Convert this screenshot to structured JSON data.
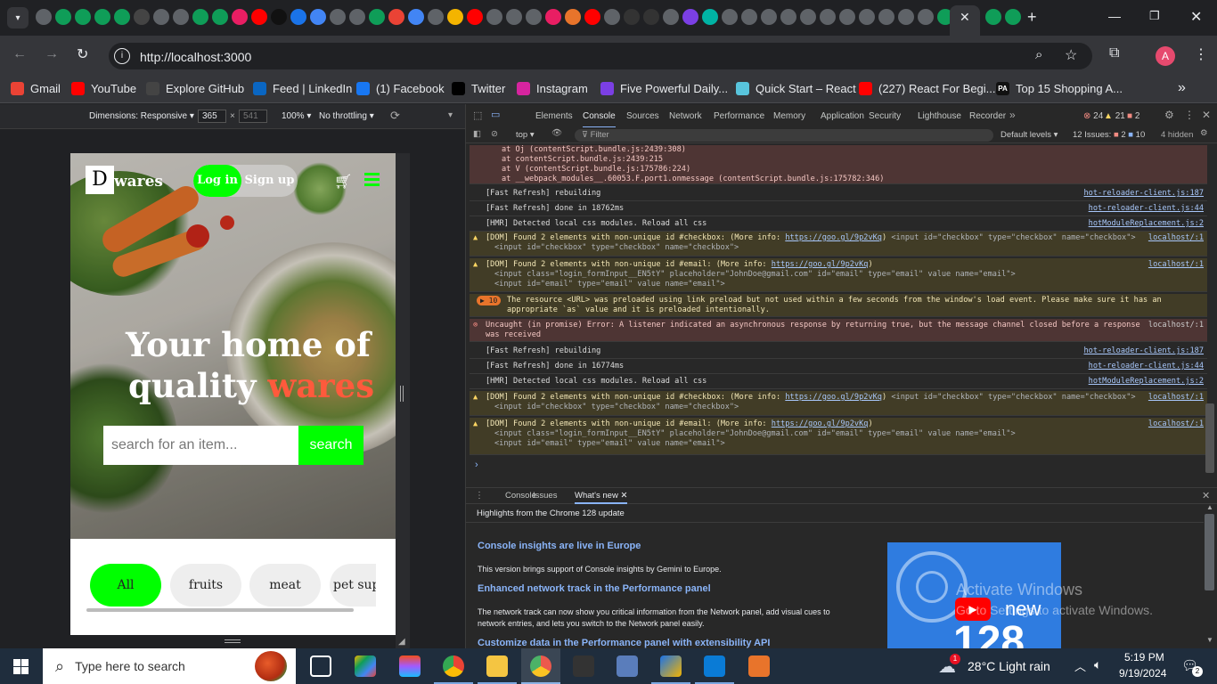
{
  "browser": {
    "url": "http://localhost:3000",
    "avatar_letter": "A",
    "bookmarks": [
      {
        "label": "Gmail",
        "icon": "gmail-icon",
        "color": "#ea4335"
      },
      {
        "label": "YouTube",
        "icon": "youtube-icon",
        "color": "#ff0000"
      },
      {
        "label": "Explore GitHub",
        "icon": "github-icon",
        "color": "#444"
      },
      {
        "label": "Feed | LinkedIn",
        "icon": "linkedin-icon",
        "color": "#0a66c2"
      },
      {
        "label": "(1) Facebook",
        "icon": "facebook-icon",
        "color": "#1877f2"
      },
      {
        "label": "Twitter",
        "icon": "x-icon",
        "color": "#000"
      },
      {
        "label": "Instagram",
        "icon": "instagram-icon",
        "color": "#d6249f"
      },
      {
        "label": "Five Powerful Daily...",
        "icon": "bookmark-icon",
        "color": "#7b3fe4"
      },
      {
        "label": "Quick Start – React",
        "icon": "react-icon",
        "color": "#58c4dc"
      },
      {
        "label": "(227) React For Begi...",
        "icon": "youtube-icon",
        "color": "#ff0000"
      },
      {
        "label": "Top 15 Shopping A...",
        "icon": "pa-icon",
        "color": "#111"
      }
    ],
    "bookmark_pa": "PA"
  },
  "device_toolbar": {
    "dimensions_label": "Dimensions: Responsive",
    "width": "365",
    "height": "541",
    "times": "×",
    "zoom": "100%",
    "throttling": "No throttling"
  },
  "site": {
    "logo_letter": "D",
    "logo_text": "wares",
    "login_label": "Log in",
    "signup_label": "Sign up",
    "hero_line1": "Your home of",
    "hero_line2_a": "quality ",
    "hero_line2_b": "wares",
    "search_placeholder": "search for an item...",
    "search_button": "search",
    "categories": [
      "All",
      "fruits",
      "meat",
      "pet supp"
    ],
    "accent": "#00ff00",
    "highlight": "#ff5a3c"
  },
  "devtools": {
    "tabs": [
      "Elements",
      "Console",
      "Sources",
      "Network",
      "Performance",
      "Memory",
      "Application",
      "Security",
      "Lighthouse",
      "Recorder"
    ],
    "more_tabs": "»",
    "err_count": "24",
    "warn_count": "21",
    "info_count": "2",
    "context": "top",
    "filter_placeholder": "Filter",
    "levels": "Default levels",
    "issues_label": "12 Issues:",
    "issues_err": "2",
    "issues_info": "10",
    "hidden": "4 hidden",
    "stack": [
      "at Oj (contentScript.bundle.js:2439:308)",
      "at contentScript.bundle.js:2439:215",
      "at V (contentScript.bundle.js:175786:224)",
      "at __webpack_modules__.60053.F.port1.onmessage (contentScript.bundle.js:175782:346)"
    ],
    "logs": {
      "fr1": "[Fast Refresh] rebuilding",
      "fr1_src": "hot-reloader-client.js:187",
      "fr2": "[Fast Refresh] done in 18762ms",
      "fr2_src": "hot-reloader-client.js:44",
      "hmr1": "[HMR] Detected local css modules. Reload all css",
      "hmr1_src": "hotModuleReplacement.js:2",
      "w1": "[DOM] Found 2 elements with non-unique id #checkbox: (More info: ",
      "w1_link": "https://goo.gl/9p2vKq",
      "w1_tail": ")",
      "w1_code": "<input id=\"checkbox\" type=\"checkbox\" name=\"checkbox\">",
      "w1_src": "localhost/:1",
      "w2": "[DOM] Found 2 elements with non-unique id #email: (More info: ",
      "w2_link": "https://goo.gl/9p2vKq",
      "w2_tail": ")",
      "w2_code1": "<input class=\"login_formInput__EN5tY\" placeholder=\"JohnDoe@gmail.com\" id=\"email\" type=\"email\" value name=\"email\">",
      "w2_code2": "<input id=\"email\" type=\"email\" value name=\"email\">",
      "w2_src": "localhost/:1",
      "w3_badge": "10",
      "w3": "The resource <URL> was preloaded using link preload but not used within a few seconds from the window's load event. Please make sure it has an",
      "w3b": "appropriate `as` value and it is preloaded intentionally.",
      "e1": "Uncaught (in promise) Error: A listener indicated an asynchronous response by returning true, but the message channel closed before a response",
      "e1b": "was received",
      "e1_src": "localhost/:1",
      "fr3": "[Fast Refresh] rebuilding",
      "fr3_src": "hot-reloader-client.js:187",
      "fr4": "[Fast Refresh] done in 16774ms",
      "fr4_src": "hot-reloader-client.js:44",
      "hmr2": "[HMR] Detected local css modules. Reload all css",
      "hmr2_src": "hotModuleReplacement.js:2",
      "prompt": "›"
    },
    "drawer_tabs": [
      "Console",
      "Issues",
      "What's new"
    ],
    "drawer_title": "Highlights from the Chrome 128 update",
    "whatsnew": [
      {
        "h": "Console insights are live in Europe",
        "p": "This version brings support of Console insights by Gemini to Europe."
      },
      {
        "h": "Enhanced network track in the Performance panel",
        "p": "The network track can now show you critical information from the Network panel, add visual cues to",
        "p2": "network entries, and lets you switch to the Network panel easily."
      },
      {
        "h": "Customize data in the Performance panel with extensibility API",
        "p": ""
      }
    ],
    "promo_new": "new",
    "promo_num": "128"
  },
  "watermark": {
    "line1": "Activate Windows",
    "line2": "Go to Settings to activate Windows."
  },
  "taskbar": {
    "search_placeholder": "Type here to search",
    "weather": "28°C  Light rain",
    "weather_badge": "1",
    "time": "5:19 PM",
    "date": "9/19/2024",
    "notif_count": "2"
  }
}
